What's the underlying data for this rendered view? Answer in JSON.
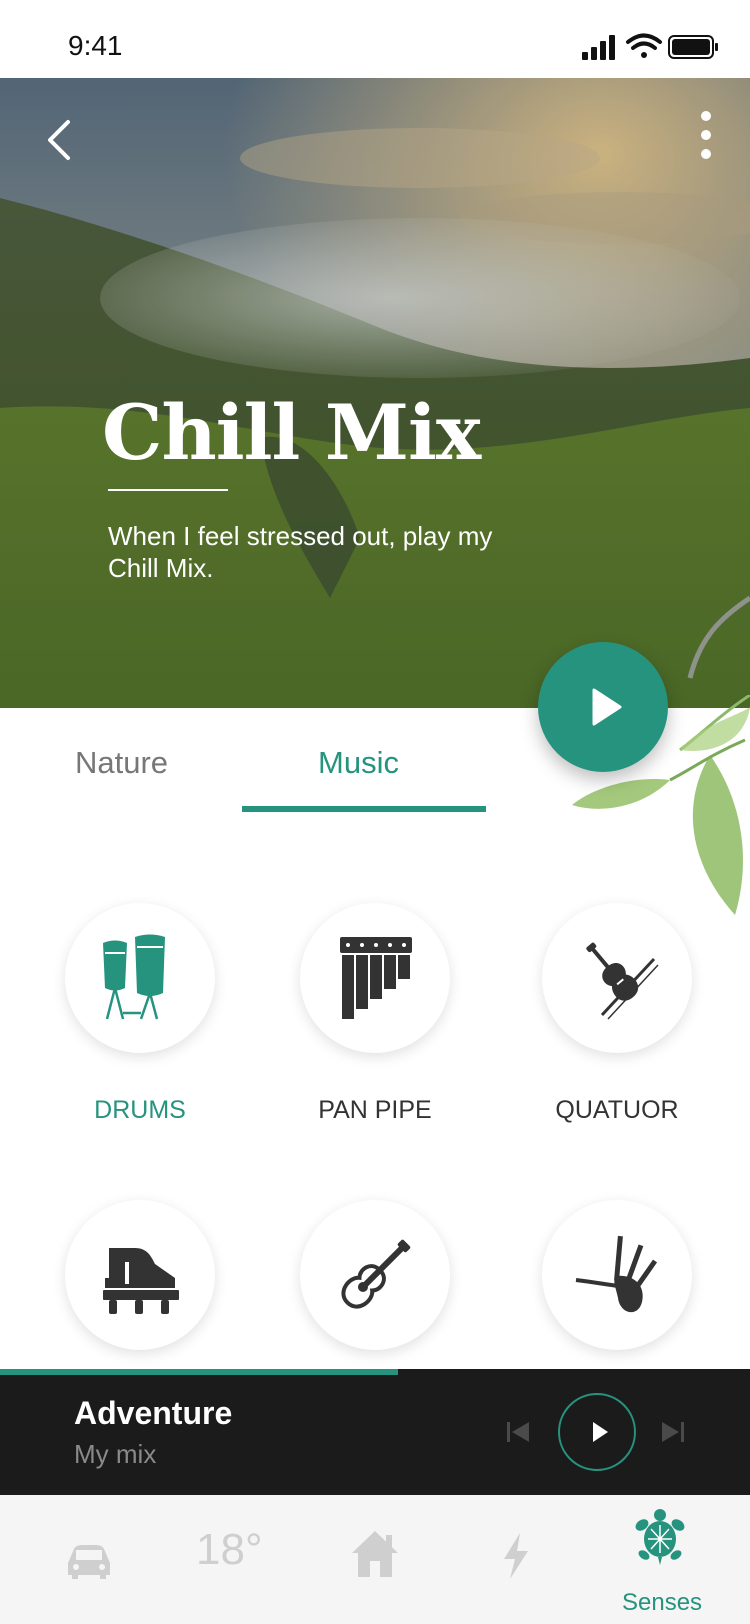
{
  "status_bar": {
    "time": "9:41"
  },
  "hero": {
    "title": "Chill Mix",
    "subtitle": "When I feel stressed out, play my Chill Mix."
  },
  "tabs": [
    {
      "label": "Nature",
      "active": false
    },
    {
      "label": "Music",
      "active": true
    }
  ],
  "instruments": [
    {
      "label": "DRUMS",
      "icon": "drums-icon",
      "active": true
    },
    {
      "label": "PAN PIPE",
      "icon": "pan-pipe-icon",
      "active": false
    },
    {
      "label": "QUATUOR",
      "icon": "violin-icon",
      "active": false
    },
    {
      "label": "",
      "icon": "piano-icon",
      "active": false
    },
    {
      "label": "",
      "icon": "guitar-icon",
      "active": false
    },
    {
      "label": "",
      "icon": "bagpipe-icon",
      "active": false
    }
  ],
  "player": {
    "title": "Adventure",
    "subtitle": "My mix",
    "progress": 0.53
  },
  "tabbar": {
    "temperature": "18°",
    "senses_label": "Senses"
  },
  "colors": {
    "accent": "#26937f",
    "player_bg": "#1b1b1b",
    "tabbar_bg": "#f5f5f5"
  }
}
